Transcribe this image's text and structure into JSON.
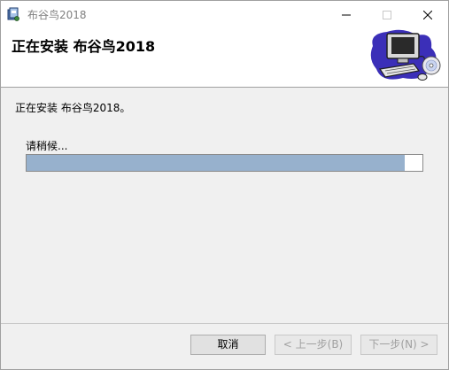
{
  "window": {
    "title": "布谷鸟2018",
    "icon": "installer-icon"
  },
  "header": {
    "title": "正在安装 布谷鸟2018",
    "banner_icon": "computer-cd-icon"
  },
  "main": {
    "status_text": "正在安装 布谷鸟2018。",
    "wait_label": "请稍候...",
    "progress": 0.955
  },
  "buttons": {
    "cancel": "取消",
    "back": "< 上一步(B)",
    "next": "下一步(N) >"
  },
  "colors": {
    "progress_fill": "#97b1cd",
    "background": "#f0f0f0"
  }
}
